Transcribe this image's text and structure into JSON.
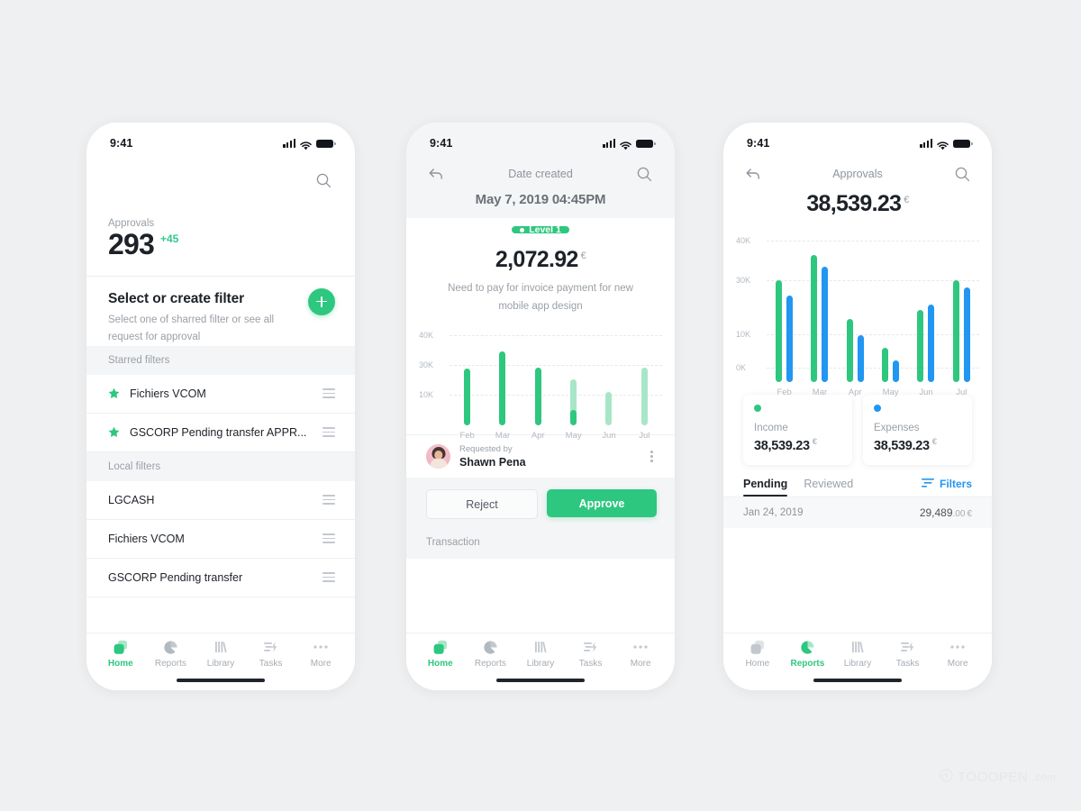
{
  "theme": {
    "green": "#2ec77f",
    "green_light": "#a8e6c8",
    "blue": "#2196f3",
    "text_dark": "#1d2228",
    "text_muted": "#9aa0a7",
    "bg": "#eff0f1"
  },
  "watermark": {
    "name": "TOOOPEN",
    "suffix": ".com",
    "icon": "tooopen-logo-icon"
  },
  "status_bar": {
    "time": "9:41",
    "icons": [
      "signal-icon",
      "wifi-icon",
      "battery-icon"
    ]
  },
  "tabbar": {
    "items": [
      {
        "label": "Home",
        "icon": "home-icon"
      },
      {
        "label": "Reports",
        "icon": "reports-pie-icon"
      },
      {
        "label": "Library",
        "icon": "library-books-icon"
      },
      {
        "label": "Tasks",
        "icon": "tasks-bolt-icon"
      },
      {
        "label": "More",
        "icon": "more-dots-icon"
      }
    ]
  },
  "phone1": {
    "search_icon": "search-icon",
    "stat_label": "Approvals",
    "stat_value": "293",
    "stat_delta": "+45",
    "filter_title": "Select or create filter",
    "filter_subtitle": "Select one of sharred filter or see all request for approval",
    "add_icon": "plus-icon",
    "sections": [
      {
        "header": "Starred filters",
        "rows": [
          {
            "name": "Fichiers VCOM",
            "starred": true
          },
          {
            "name": "GSCORP Pending transfer APPR...",
            "starred": true
          }
        ]
      },
      {
        "header": "Local filters",
        "rows": [
          {
            "name": "LGCASH",
            "starred": false
          },
          {
            "name": "Fichiers VCOM",
            "starred": false
          },
          {
            "name": "GSCORP Pending transfer",
            "starred": false
          }
        ]
      }
    ],
    "active_tab": "Home"
  },
  "phone2": {
    "back_icon": "back-arrow-icon",
    "nav_title": "Date created",
    "search_icon": "search-icon",
    "date": "May 7, 2019 04:45PM",
    "badge": "Level 1",
    "amount": "2,072.92",
    "currency": "€",
    "description": "Need to pay for invoice payment for new mobile app design",
    "requested_by_label": "Requested by",
    "requester": "Shawn Pena",
    "avatar_icon": "user-avatar",
    "menu_icon": "kebab-menu-icon",
    "reject_label": "Reject",
    "approve_label": "Approve",
    "transaction_label": "Transaction",
    "active_tab": "Home",
    "chart_data": {
      "type": "bar",
      "title": "",
      "xlabel": "",
      "ylabel": "",
      "categories": [
        "Feb",
        "Mar",
        "Apr",
        "May",
        "Jun",
        "Jul"
      ],
      "values": [
        25000,
        33000,
        25500,
        20000,
        14500,
        25500
      ],
      "highlight_values": [
        25000,
        33000,
        25500,
        5000,
        0,
        0
      ],
      "muted_index": [
        3,
        4,
        5
      ],
      "ytick_labels": [
        "40K",
        "30K",
        "10K"
      ],
      "ytick_values": [
        40000,
        30000,
        10000
      ],
      "ylim": [
        0,
        44000
      ],
      "grid": true,
      "legend": "none",
      "series_color": "#2ec77f",
      "muted_color": "#a8e6c8"
    }
  },
  "phone3": {
    "back_icon": "back-arrow-icon",
    "nav_title": "Approvals",
    "search_icon": "search-icon",
    "amount": "38,539.23",
    "currency": "€",
    "cards": [
      {
        "title": "Income",
        "value": "38,539.23",
        "currency": "€",
        "color": "#2ec77f",
        "dot_icon": "income-dot-icon"
      },
      {
        "title": "Expenses",
        "value": "38,539.23",
        "currency": "€",
        "color": "#2196f3",
        "dot_icon": "expenses-dot-icon"
      }
    ],
    "tabs": [
      {
        "label": "Pending",
        "active": true
      },
      {
        "label": "Reviewed",
        "active": false
      }
    ],
    "filters_label": "Filters",
    "filters_icon": "filter-lines-icon",
    "transaction": {
      "date": "Jan 24, 2019",
      "amount": "29,489",
      "decimals": ".00",
      "currency": "€"
    },
    "active_tab": "Reports",
    "chart_data": {
      "type": "bar",
      "title": "",
      "xlabel": "",
      "ylabel": "",
      "categories": [
        "Feb",
        "Mar",
        "Apr",
        "May",
        "Jun",
        "Jul"
      ],
      "series": [
        {
          "name": "Income",
          "color": "#2ec77f",
          "values": [
            33000,
            41500,
            17500,
            7500,
            21000,
            33000
          ]
        },
        {
          "name": "Expenses",
          "color": "#2196f3",
          "values": [
            27500,
            37000,
            12000,
            4500,
            23000,
            30500
          ]
        }
      ],
      "ytick_labels": [
        "40K",
        "30K",
        "10K",
        "0K"
      ],
      "ytick_values": [
        40000,
        30000,
        10000,
        0
      ],
      "ylim": [
        -2500,
        44000
      ],
      "grid": true,
      "legend": "cards-below"
    }
  }
}
